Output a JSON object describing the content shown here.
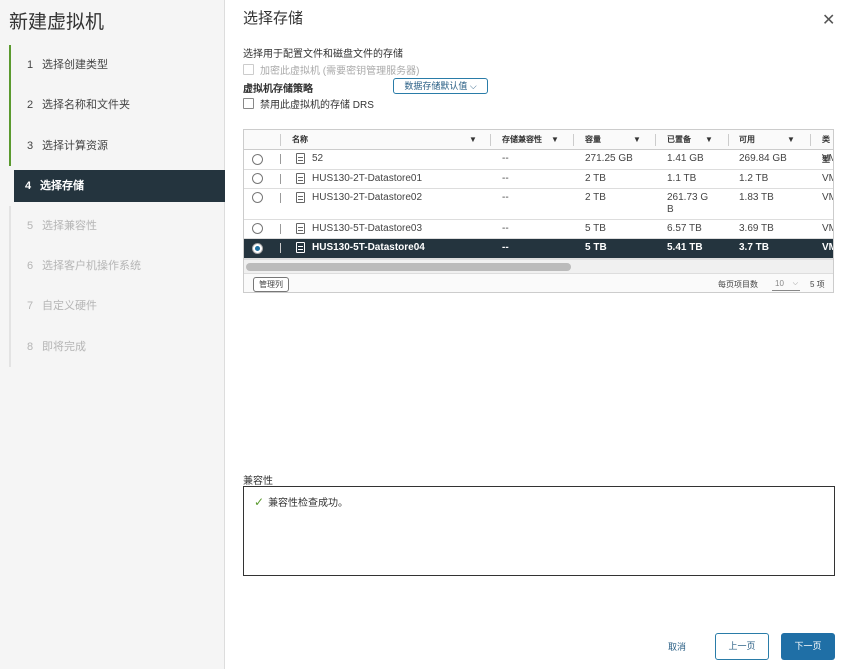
{
  "wizard": {
    "title": "新建虚拟机",
    "steps": [
      {
        "num": "1",
        "label": "选择创建类型"
      },
      {
        "num": "2",
        "label": "选择名称和文件夹"
      },
      {
        "num": "3",
        "label": "选择计算资源"
      },
      {
        "num": "4",
        "label": "选择存储"
      },
      {
        "num": "5",
        "label": "选择兼容性"
      },
      {
        "num": "6",
        "label": "选择客户机操作系统"
      },
      {
        "num": "7",
        "label": "自定义硬件"
      },
      {
        "num": "8",
        "label": "即将完成"
      }
    ]
  },
  "page": {
    "title": "选择存储",
    "close_icon": "✕",
    "subtitle": "选择用于配置文件和磁盘文件的存储",
    "encrypt_label": "加密此虚拟机 (需要密钥管理服务器)",
    "policy_label": "虚拟机存储策略",
    "policy_value": "数据存储默认值 ⌵",
    "drs_label": "禁用此虚拟机的存储 DRS"
  },
  "grid": {
    "columns": [
      "名称",
      "存储兼容性",
      "容量",
      "已置备",
      "可用",
      "类型"
    ],
    "rows": [
      {
        "name": "52",
        "compat": "--",
        "capacity": "271.25 GB",
        "provisioned": "1.41 GB",
        "free": "269.84 GB",
        "type": "VM"
      },
      {
        "name": "HUS130-2T-Datastore01",
        "compat": "--",
        "capacity": "2 TB",
        "provisioned": "1.1 TB",
        "free": "1.2 TB",
        "type": "VM"
      },
      {
        "name": "HUS130-2T-Datastore02",
        "compat": "--",
        "capacity": "2 TB",
        "provisioned": "261.73 G\nB",
        "free": "1.83 TB",
        "type": "VM"
      },
      {
        "name": "HUS130-5T-Datastore03",
        "compat": "--",
        "capacity": "5 TB",
        "provisioned": "6.57 TB",
        "free": "3.69 TB",
        "type": "VM"
      },
      {
        "name": "HUS130-5T-Datastore04",
        "compat": "--",
        "capacity": "5 TB",
        "provisioned": "5.41 TB",
        "free": "3.7 TB",
        "type": "VM"
      }
    ],
    "selected_index": 4,
    "manage_columns": "管理列",
    "per_page_label": "每页项目数",
    "per_page_value": "10",
    "total": "5 项"
  },
  "compatibility": {
    "label": "兼容性",
    "message": "兼容性检查成功。"
  },
  "buttons": {
    "cancel": "取消",
    "back": "上一页",
    "next": "下一页"
  },
  "colors": {
    "active_step": "#24343e",
    "done_indicator": "#5b9a2f",
    "primary": "#1f6fa6"
  }
}
